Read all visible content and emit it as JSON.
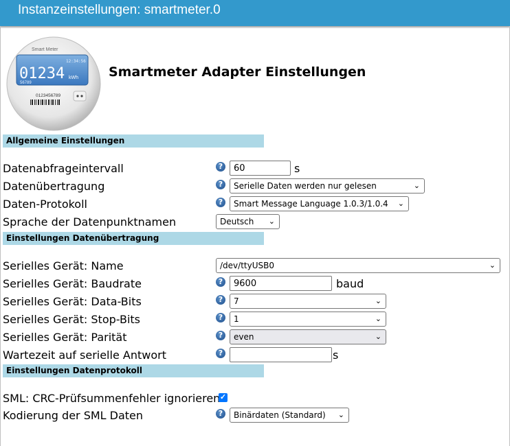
{
  "window": {
    "title": "Instanzeinstellungen: smartmeter.0"
  },
  "header": {
    "heading": "Smartmeter Adapter Einstellungen",
    "meter": {
      "brand": "Smart Meter",
      "time": "12:34:56",
      "reading": "01234",
      "unit": "kWh",
      "small_number": "56789",
      "serial": "0123456789"
    }
  },
  "sections": {
    "general": "Allgemeine Einstellungen",
    "transmission": "Einstellungen Datenübertragung",
    "protocol": "Einstellungen Datenprotokoll"
  },
  "fields": {
    "interval": {
      "label": "Datenabfrageintervall",
      "value": "60",
      "unit": "s"
    },
    "transfer": {
      "label": "Datenübertragung",
      "value": "Serielle Daten werden nur gelesen"
    },
    "protocol": {
      "label": "Daten-Protokoll",
      "value": "Smart Message Language 1.0.3/1.0.4"
    },
    "language": {
      "label": "Sprache der Datenpunktnamen",
      "value": "Deutsch"
    },
    "device": {
      "label": "Serielles Gerät: Name",
      "value": "/dev/ttyUSB0"
    },
    "baud": {
      "label": "Serielles Gerät: Baudrate",
      "value": "9600",
      "unit": "baud"
    },
    "databits": {
      "label": "Serielles Gerät: Data-Bits",
      "value": "7"
    },
    "stopbits": {
      "label": "Serielles Gerät: Stop-Bits",
      "value": "1"
    },
    "parity": {
      "label": "Serielles Gerät: Parität",
      "value": "even"
    },
    "wait": {
      "label": "Wartezeit auf serielle Antwort",
      "value": "",
      "unit": "s"
    },
    "crc": {
      "label": "SML: CRC-Prüfsummenfehler ignorieren",
      "checked": true
    },
    "encoding": {
      "label": "Kodierung der SML Daten",
      "value": "Binärdaten (Standard)"
    }
  },
  "icons": {
    "help": "question-mark-help-icon",
    "dropdown": "chevron-down-icon",
    "check": "check-icon"
  },
  "colors": {
    "titlebar": "#3399cc",
    "section": "#add8e6",
    "checkbox": "#0075ff"
  }
}
